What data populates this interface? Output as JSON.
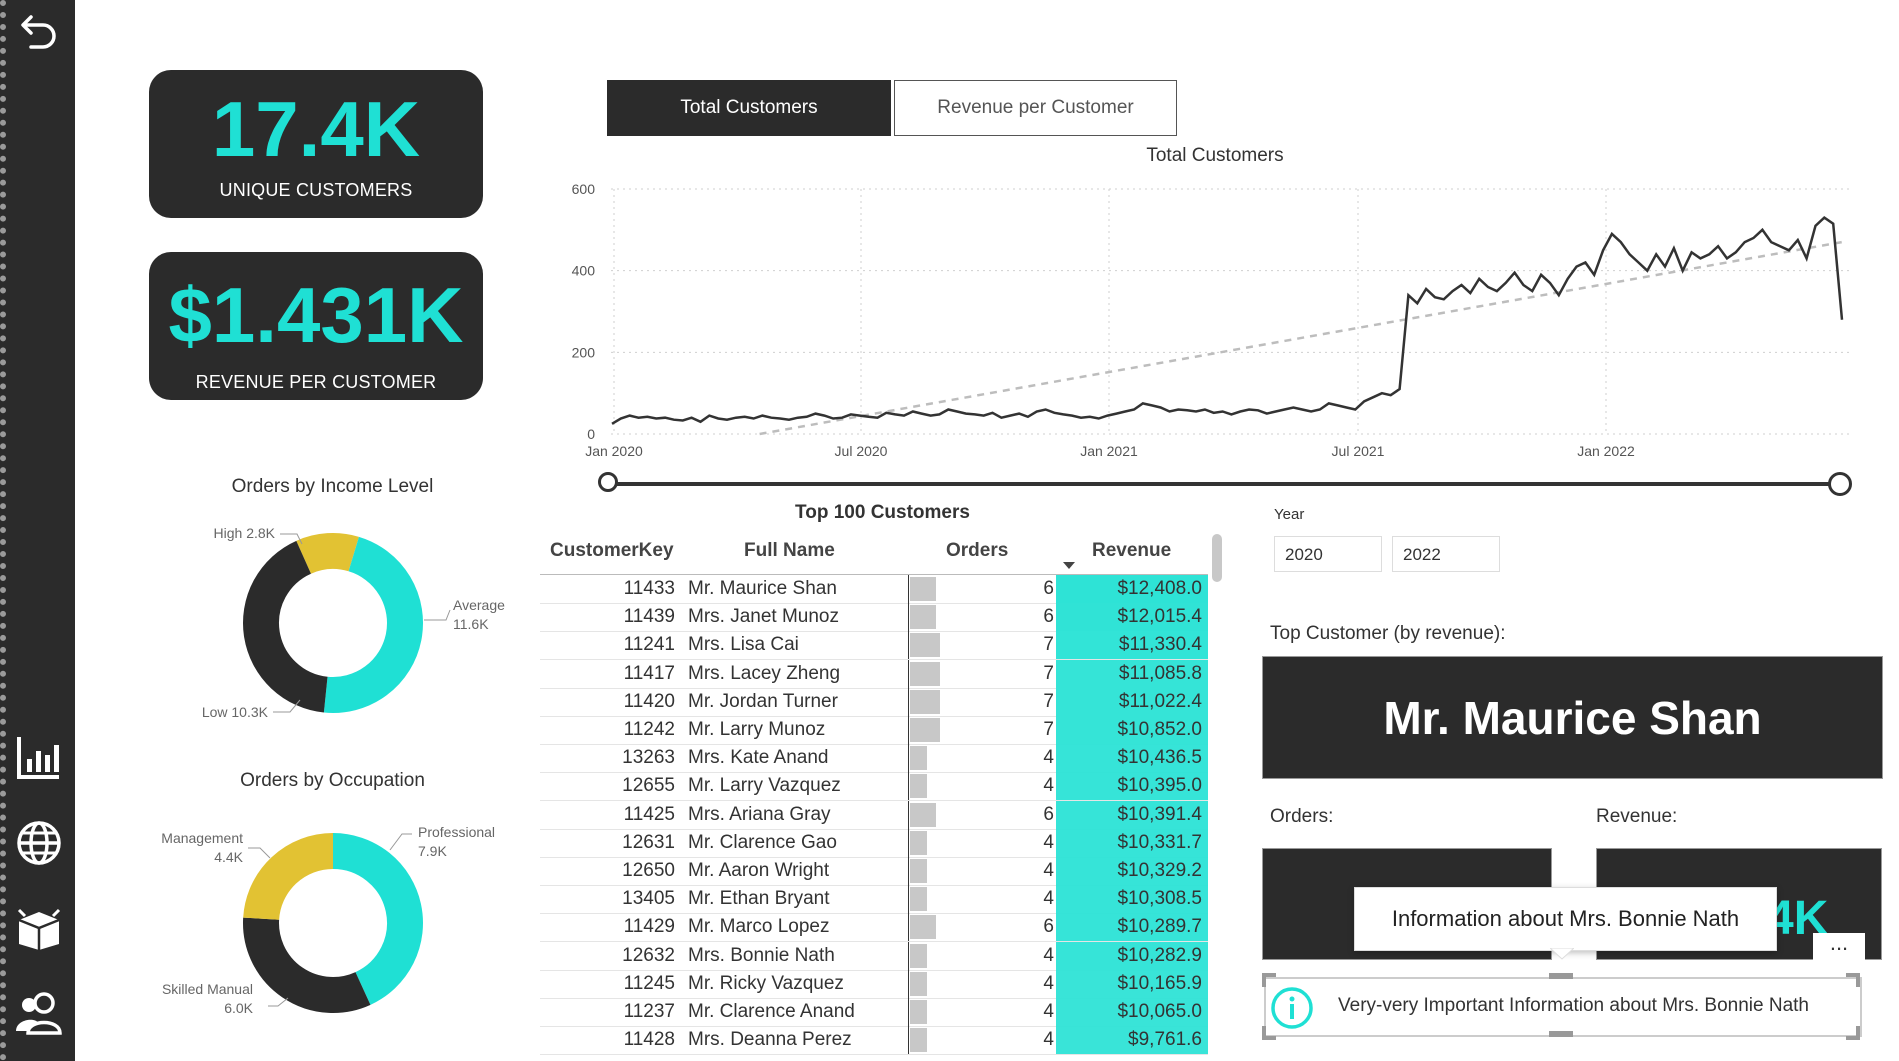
{
  "nav": {
    "icons": [
      "back-arrow-icon",
      "bar-chart-icon",
      "globe-icon",
      "box-icon",
      "people-icon"
    ]
  },
  "kpis": [
    {
      "value": "17.4K",
      "label": "UNIQUE CUSTOMERS"
    },
    {
      "value": "$1.431K",
      "label": "REVENUE PER CUSTOMER"
    }
  ],
  "tabs": [
    {
      "label": "Total Customers",
      "active": true
    },
    {
      "label": "Revenue per Customer",
      "active": false
    }
  ],
  "chart_data": [
    {
      "type": "line",
      "title": "Total Customers",
      "x_ticks": [
        "Jan 2020",
        "Jul 2020",
        "Jan 2021",
        "Jul 2021",
        "Jan 2022"
      ],
      "y_ticks": [
        "0",
        "200",
        "400",
        "600"
      ],
      "ylim": [
        0,
        600
      ],
      "x_range": [
        "2020-01",
        "2022-06"
      ],
      "grid": true,
      "series": [
        {
          "values": [
            25,
            38,
            45,
            40,
            42,
            38,
            40,
            35,
            33,
            40,
            30,
            45,
            38,
            35,
            40,
            42,
            38,
            45,
            40,
            38,
            35,
            40,
            42,
            50,
            45,
            38,
            40,
            48,
            45,
            42,
            40,
            52,
            48,
            45,
            55,
            50,
            45,
            48,
            60,
            55,
            50,
            48,
            45,
            52,
            40,
            45,
            50,
            42,
            55,
            60,
            52,
            48,
            45,
            40,
            42,
            38,
            45,
            50,
            55,
            60,
            75,
            70,
            65,
            55,
            60,
            58,
            55,
            60,
            52,
            55,
            48,
            55,
            60,
            58,
            50,
            55,
            60,
            65,
            60,
            55,
            60,
            75,
            70,
            65,
            60,
            80,
            90,
            100,
            95,
            110,
            340,
            320,
            355,
            335,
            330,
            350,
            365,
            345,
            380,
            360,
            350,
            370,
            395,
            365,
            350,
            390,
            370,
            340,
            380,
            410,
            420,
            390,
            450,
            490,
            470,
            440,
            420,
            400,
            440,
            410,
            455,
            400,
            445,
            430,
            440,
            460,
            430,
            445,
            470,
            480,
            500,
            470,
            460,
            450,
            475,
            430,
            510,
            530,
            515,
            280
          ]
        },
        {
          "values_trend": [
            [
              0.3,
              0
            ],
            [
              2.5,
              470
            ]
          ]
        }
      ],
      "slider": {
        "start": 0,
        "end": 1
      }
    },
    {
      "type": "pie",
      "title": "Orders by Income Level",
      "labels": [
        "High",
        "Average",
        "Low"
      ],
      "label_values": [
        "2.8K",
        "11.6K",
        "10.3K"
      ],
      "values": [
        2.8,
        11.6,
        10.3
      ],
      "colors": [
        "#e2c233",
        "#1fe0d4",
        "#2b2b2b"
      ]
    },
    {
      "type": "pie",
      "title": "Orders by Occupation",
      "labels": [
        "Professional",
        "Skilled Manual",
        "Management"
      ],
      "label_values": [
        "7.9K",
        "6.0K",
        "4.4K"
      ],
      "values": [
        7.9,
        6.0,
        4.4
      ],
      "colors": [
        "#1fe0d4",
        "#2b2b2b",
        "#e2c233"
      ]
    }
  ],
  "table": {
    "title": "Top 100 Customers",
    "headers": [
      "CustomerKey",
      "Full Name",
      "Orders",
      "Revenue"
    ],
    "rows": [
      {
        "key": "11433",
        "name": "Mr. Maurice Shan",
        "orders": 6,
        "revenue": "$12,408.0",
        "rev": 12408.0
      },
      {
        "key": "11439",
        "name": "Mrs. Janet Munoz",
        "orders": 6,
        "revenue": "$12,015.4",
        "rev": 12015.4
      },
      {
        "key": "11241",
        "name": "Mrs. Lisa Cai",
        "orders": 7,
        "revenue": "$11,330.4",
        "rev": 11330.4
      },
      {
        "key": "11417",
        "name": "Mrs. Lacey Zheng",
        "orders": 7,
        "revenue": "$11,085.8",
        "rev": 11085.8
      },
      {
        "key": "11420",
        "name": "Mr. Jordan Turner",
        "orders": 7,
        "revenue": "$11,022.4",
        "rev": 11022.4
      },
      {
        "key": "11242",
        "name": "Mr. Larry Munoz",
        "orders": 7,
        "revenue": "$10,852.0",
        "rev": 10852.0
      },
      {
        "key": "13263",
        "name": "Mrs. Kate Anand",
        "orders": 4,
        "revenue": "$10,436.5",
        "rev": 10436.5
      },
      {
        "key": "12655",
        "name": "Mr. Larry Vazquez",
        "orders": 4,
        "revenue": "$10,395.0",
        "rev": 10395.0
      },
      {
        "key": "11425",
        "name": "Mrs. Ariana Gray",
        "orders": 6,
        "revenue": "$10,391.4",
        "rev": 10391.4
      },
      {
        "key": "12631",
        "name": "Mr. Clarence Gao",
        "orders": 4,
        "revenue": "$10,331.7",
        "rev": 10331.7
      },
      {
        "key": "12650",
        "name": "Mr. Aaron Wright",
        "orders": 4,
        "revenue": "$10,329.2",
        "rev": 10329.2
      },
      {
        "key": "13405",
        "name": "Mr. Ethan Bryant",
        "orders": 4,
        "revenue": "$10,308.5",
        "rev": 10308.5
      },
      {
        "key": "11429",
        "name": "Mr. Marco Lopez",
        "orders": 6,
        "revenue": "$10,289.7",
        "rev": 10289.7
      },
      {
        "key": "12632",
        "name": "Mrs. Bonnie Nath",
        "orders": 4,
        "revenue": "$10,282.9",
        "rev": 10282.9
      },
      {
        "key": "11245",
        "name": "Mr. Ricky Vazquez",
        "orders": 4,
        "revenue": "$10,165.9",
        "rev": 10165.9
      },
      {
        "key": "11237",
        "name": "Mr. Clarence Anand",
        "orders": 4,
        "revenue": "$10,065.0",
        "rev": 10065.0
      },
      {
        "key": "11428",
        "name": "Mrs. Deanna Perez",
        "orders": 4,
        "revenue": "$9,761.6",
        "rev": 9761.6
      }
    ]
  },
  "year_slicer": {
    "label": "Year",
    "from": "2020",
    "to": "2022"
  },
  "top_customer": {
    "label": "Top Customer (by revenue):",
    "name": "Mr. Maurice Shan"
  },
  "orders_label": "Orders:",
  "revenue_label": "Revenue:",
  "revenue_partial": "4K",
  "tooltip": {
    "text": "Information about Mrs. Bonnie Nath"
  },
  "more_options": "...",
  "info_box": {
    "text": "Very-very Important Information about Mrs. Bonnie Nath"
  },
  "colors": {
    "accent": "#1fe0d4",
    "dark": "#2b2b2b",
    "yellow": "#e2c233",
    "revenue_fill": "#2ee3d6"
  }
}
